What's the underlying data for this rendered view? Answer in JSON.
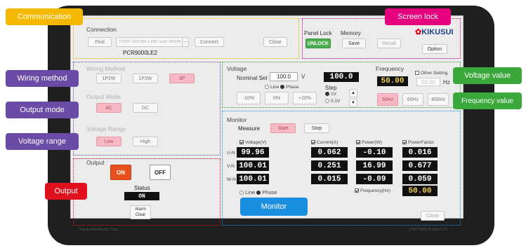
{
  "connection": {
    "title": "Connection",
    "find": "Find",
    "address": "TCPIP::169.254.1.183::inst0::INSTR",
    "connect": "Connect",
    "close": "Close",
    "device": "PCR9000LE2"
  },
  "panel_lock": {
    "title": "Panel Lock",
    "unlock": "UNLOCK"
  },
  "memory": {
    "title": "Memory",
    "save": "Save",
    "recall": "Recall"
  },
  "logo": {
    "text": "KIKUSUI"
  },
  "option_label": "Option",
  "wiring": {
    "title": "Wiring Method",
    "options": [
      "1P2W",
      "1P3W",
      "3P"
    ],
    "selected": "3P"
  },
  "output_mode": {
    "title": "Output Mode",
    "options": [
      "AC",
      "DC"
    ],
    "selected": "AC"
  },
  "voltage_range": {
    "title": "Voltage Range",
    "options": [
      "Low",
      "High"
    ],
    "selected": "Low"
  },
  "output": {
    "title": "Output",
    "on": "ON",
    "off": "OFF",
    "status_label": "Status",
    "status_value": "ON",
    "alarm_clear_1": "Alarm",
    "alarm_clear_2": "Clear"
  },
  "voltage": {
    "title": "Voltage",
    "nominal_label": "Nominal Set",
    "nominal_value": "100.0",
    "unit": "V",
    "line": "Line",
    "phase": "Phase",
    "display": "100.0",
    "step_label": "Step",
    "step_1": "1V",
    "step_2": "0.1V",
    "pct_buttons": [
      "-10%",
      "0%",
      "+10%"
    ]
  },
  "frequency": {
    "title": "Frequency",
    "other_label": "Other Setting",
    "other_value": "50.00",
    "unit": "Hz",
    "display": "50.00",
    "buttons": [
      "50Hz",
      "60Hz",
      "400Hz"
    ]
  },
  "monitor": {
    "title": "Monitor",
    "measure_label": "Measure",
    "start": "Start",
    "stop": "Stop",
    "columns": [
      "Voltage(V)",
      "Current(A)",
      "Power(W)",
      "PowerFactor"
    ],
    "rows": [
      {
        "label": "U-N",
        "values": [
          "99.96",
          "0.062",
          "-0.10",
          "0.016"
        ]
      },
      {
        "label": "V-N",
        "values": [
          "100.01",
          "0.251",
          "16.99",
          "0.677"
        ]
      },
      {
        "label": "W-N",
        "values": [
          "100.01",
          "0.015",
          "-0.09",
          "0.059"
        ]
      }
    ],
    "line": "Line",
    "phase": "Phase",
    "freq_label": "Frequency(Hz)",
    "freq_value": "50.00",
    "close": "Close"
  },
  "footer": {
    "company": "Kikusui Electronics Corp.",
    "version": "[PRC7060]  Version 1.00"
  },
  "callouts": {
    "communication": "Communication",
    "screen_lock": "Screen lock",
    "wiring_method": "Wiring method",
    "output_mode": "Output mode",
    "voltage_range": "Voltage range",
    "output": "Output",
    "voltage_value": "Voltage value",
    "frequency_value": "Frequency value",
    "monitor": "Monitor"
  },
  "colors": {
    "yellow": "#f5b800",
    "magenta": "#e6007e",
    "purple": "#6a4ba5",
    "red": "#e0101e",
    "green": "#3aa83a",
    "blue": "#1a8fe0"
  }
}
